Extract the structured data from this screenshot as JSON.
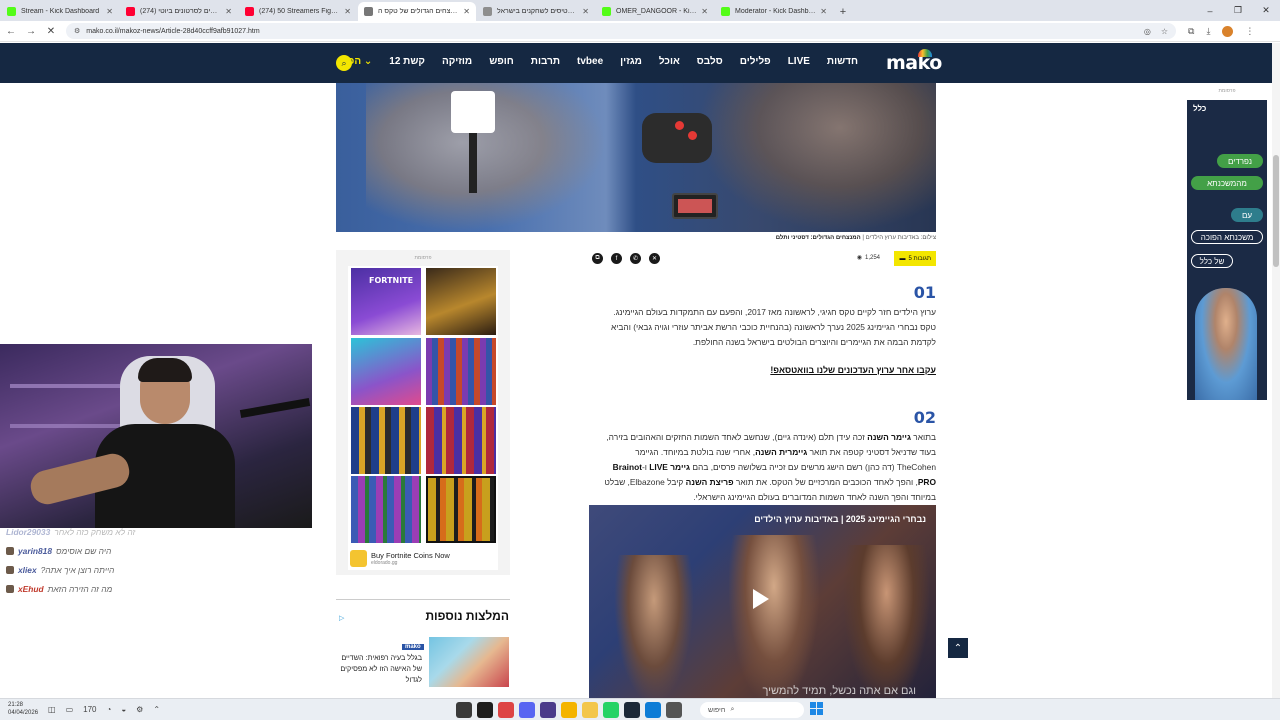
{
  "browser": {
    "tabs": [
      {
        "title": "Stream - Kick Dashboard",
        "color": "#53fc18"
      },
      {
        "title": "(274) מגיבים לסרטונים ביוטי",
        "color": "#ff0033"
      },
      {
        "title": "(274) 50 Streamers Fight for $1",
        "color": "#ff0033"
      },
      {
        "title": "אלה המנצחים הגדולים של טקס ה...",
        "color": "#777777",
        "active": true
      },
      {
        "title": "עלות כרטיסים לשחקנים בישראל",
        "color": "#8e8e8e"
      },
      {
        "title": "OMER_DANGOOR - Kick Profile",
        "color": "#53fc18"
      },
      {
        "title": "Moderator - Kick Dashboard",
        "color": "#53fc18"
      }
    ],
    "new_tab": "+",
    "window_controls": [
      "–",
      "❐",
      "✕"
    ],
    "url": "mako.co.il/makoz-news/Article-28d40ccff9afb91027.htm"
  },
  "site": {
    "logo": "mako",
    "nav": [
      "חדשות",
      "LIVE",
      "פלילים",
      "סלבס",
      "אוכל",
      "מגזין",
      "tvbee",
      "תרבות",
      "חופש",
      "מוזיקה",
      "קשת 12",
      "הכל"
    ],
    "search_icon": "search-icon"
  },
  "article": {
    "caption_bold": "המנצחים הגדולים: דסטיני ותלם",
    "caption_credit": "צילום: באדיבות ערוץ הילדים",
    "comments_label": "5 תגובות",
    "views": "1,254",
    "share_icons": [
      "copy-link-icon",
      "facebook-icon",
      "whatsapp-icon",
      "x-icon"
    ],
    "sec1_num": "01",
    "sec1_lines": [
      "ערוץ הילדים חזר לקיים טקס חגיגי, לראשונה מאז 2017, והפעם עם התמקדות בעולם הגיימינג.",
      "טקס נבחרי הגיימינג 2025 נערך לראשונה (בהנחיית כוכבי הרשת אביתר עוזרי וגויה גבאי) והביא",
      "לקדמת הבמה את הגיימרים והיוצרים הבולטים בישראל בשנה החולפת."
    ],
    "follow_link": "עקבו אחר ערוץ העדכונים שלנו בוואטסאפ!",
    "sec2_num": "02",
    "sec2_l1a": "בתואר ",
    "sec2_l1b": "גיימר השנה",
    "sec2_l1c": " זכה עידן תלם (אינדה גיים), שנחשב לאחד השמות החזקים והאהובים בזירה,",
    "sec2_l2a": "בעוד שדניאל דסטיני קטפה את תואר ",
    "sec2_l2b": "גיימרית השנה",
    "sec2_l2c": ", אחרי שנה בולטת במיוחד. הגיימר",
    "sec2_l3a": "TheCohen (דה כהן) רשם הישג מרשים עם זכייה בשלושה פרסים, בהם ",
    "sec2_l3b": "גיימר LIVE",
    "sec2_l3c": " ו-",
    "sec2_l3d": "Brainot",
    "sec2_l4a": "PRO",
    "sec2_l4b": ", והפך לאחד הכוכבים המרכזיים של הטקס. את תואר ",
    "sec2_l4c": "פריצת השנה",
    "sec2_l4d": " קיבל Elbazone, שבלט",
    "sec2_l5": "במיוחד והפך השנה לאחד השמות המדוברים בעולם הגיימינג הישראלי.",
    "video_title": "נבחרי הגיימינג 2025 | באדיבות ערוץ הילדים",
    "video_subtitle": "וגם אם אתה נכשל, תמיד להמשיך"
  },
  "ad": {
    "label": "פרסומת",
    "fortnite_label": "FORTNITE",
    "cta": "Buy Fortnite Coins Now",
    "domain": "eldorado.gg"
  },
  "more": {
    "title": "המלצות נוספות",
    "tag": "mako",
    "item_title": "בגלל בעיה רפואית: השדיים של האישה הזו לא מפסיקים לגדול"
  },
  "sidead": {
    "label": "פרסומת",
    "brand": "כלל",
    "pills": [
      {
        "text": "נפרדים",
        "color": "#43a047"
      },
      {
        "text": "מהמשכנתא",
        "color": "#43a047"
      },
      {
        "text": "עם",
        "color": "#2e7d8c"
      },
      {
        "text": "משכנתא הפוכה",
        "color": "#1b2a45"
      },
      {
        "text": "של כלל",
        "color": "#1b2a45"
      }
    ]
  },
  "stream": {
    "chat": [
      {
        "user": "Lidor29033",
        "msg": "זה לא משחק כזה לאחר"
      },
      {
        "user": "yarin818",
        "msg": "היה שם אוסימס"
      },
      {
        "user": "xliex",
        "msg": "הייתה רוצן איך אתה?"
      },
      {
        "user": "xEhud",
        "msg": "מה זה הזירה הזאת"
      }
    ]
  },
  "taskbar": {
    "time": "21:28",
    "date": "04/04/2026",
    "search_placeholder": "חיפוש",
    "sys_icons": [
      "chat-icon",
      "monitor-icon",
      "volume-icon",
      "wifi-icon",
      "settings-icon",
      "chevron-up-icon"
    ],
    "sys_label": "170"
  }
}
